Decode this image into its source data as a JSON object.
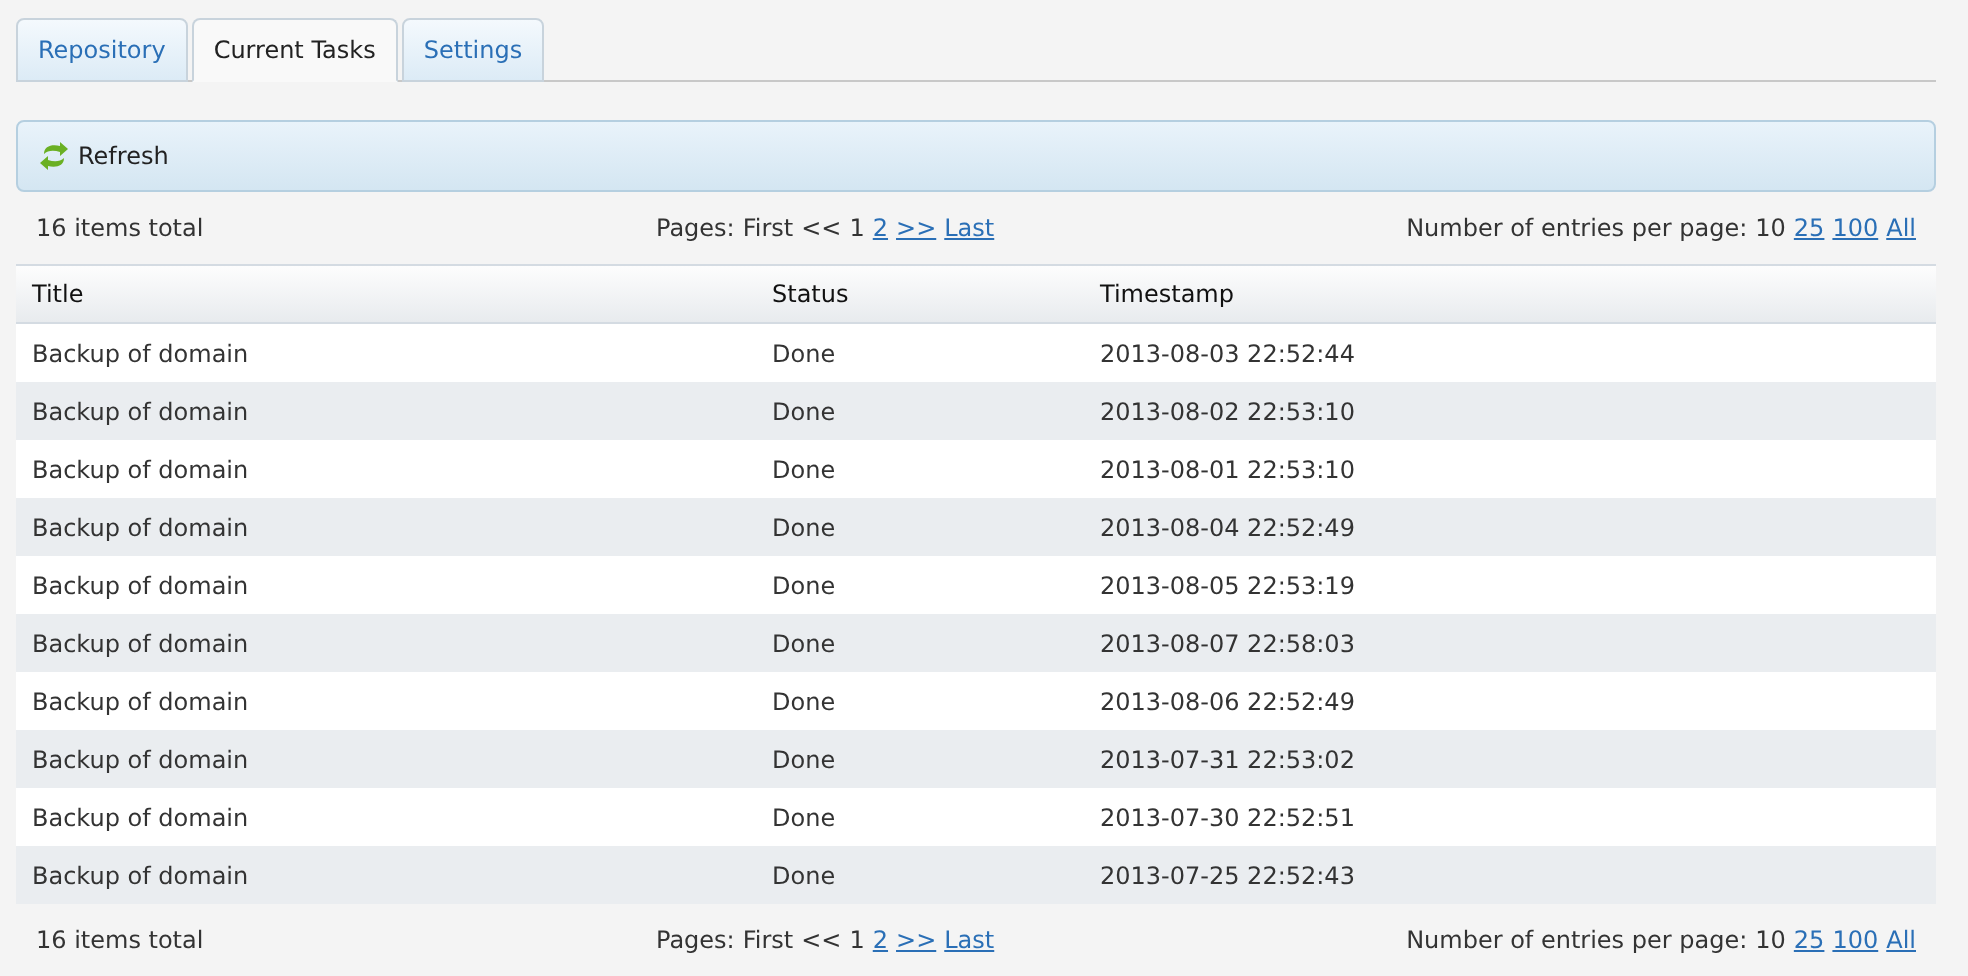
{
  "tabs": [
    {
      "label": "Repository",
      "selected": false
    },
    {
      "label": "Current Tasks",
      "selected": true
    },
    {
      "label": "Settings",
      "selected": false
    }
  ],
  "toolbar": {
    "refresh_button": "Refresh"
  },
  "pager_top": {
    "total": "16 items total",
    "pages_label": "Pages:",
    "pages": [
      {
        "kind": "text",
        "label": "First"
      },
      {
        "kind": "text",
        "label": "<<"
      },
      {
        "kind": "text",
        "label": "1"
      },
      {
        "kind": "link",
        "label": "2"
      },
      {
        "kind": "link",
        "label": ">>"
      },
      {
        "kind": "link",
        "label": "Last"
      }
    ],
    "per_page_label": "Number of entries per page:",
    "per_page": [
      {
        "kind": "text",
        "label": "10"
      },
      {
        "kind": "link",
        "label": "25"
      },
      {
        "kind": "link",
        "label": "100"
      },
      {
        "kind": "link",
        "label": "All"
      }
    ]
  },
  "table": {
    "columns": [
      "Title",
      "Status",
      "Timestamp"
    ],
    "rows": [
      [
        "Backup of domain",
        "Done",
        "2013-08-03 22:52:44"
      ],
      [
        "Backup of domain",
        "Done",
        "2013-08-02 22:53:10"
      ],
      [
        "Backup of domain",
        "Done",
        "2013-08-01 22:53:10"
      ],
      [
        "Backup of domain",
        "Done",
        "2013-08-04 22:52:49"
      ],
      [
        "Backup of domain",
        "Done",
        "2013-08-05 22:53:19"
      ],
      [
        "Backup of domain",
        "Done",
        "2013-08-07 22:58:03"
      ],
      [
        "Backup of domain",
        "Done",
        "2013-08-06 22:52:49"
      ],
      [
        "Backup of domain",
        "Done",
        "2013-07-31 22:53:02"
      ],
      [
        "Backup of domain",
        "Done",
        "2013-07-30 22:52:51"
      ],
      [
        "Backup of domain",
        "Done",
        "2013-07-25 22:52:43"
      ]
    ]
  },
  "pager_bottom": {
    "total": "16 items total",
    "pages_label": "Pages:",
    "pages": [
      {
        "kind": "text",
        "label": "First"
      },
      {
        "kind": "text",
        "label": "<<"
      },
      {
        "kind": "text",
        "label": "1"
      },
      {
        "kind": "link",
        "label": "2"
      },
      {
        "kind": "link",
        "label": ">>"
      },
      {
        "kind": "link",
        "label": "Last"
      }
    ],
    "per_page_label": "Number of entries per page:",
    "per_page": [
      {
        "kind": "text",
        "label": "10"
      },
      {
        "kind": "link",
        "label": "25"
      },
      {
        "kind": "link",
        "label": "100"
      },
      {
        "kind": "link",
        "label": "All"
      }
    ]
  }
}
